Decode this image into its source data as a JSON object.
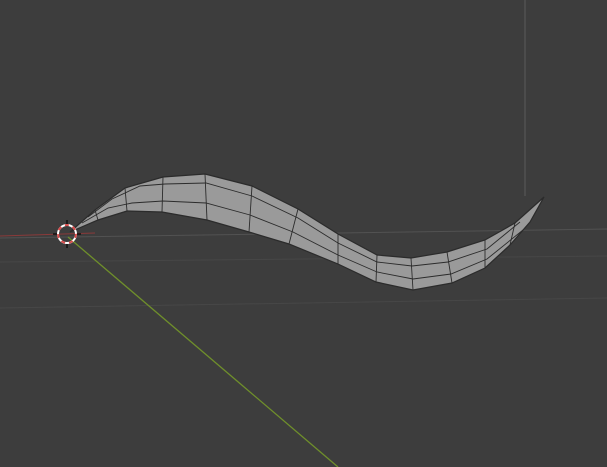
{
  "app": {
    "name": "",
    "mode": "3d-viewport"
  },
  "viewport": {
    "background_color": "#3d3d3d",
    "grid": {
      "visible": true,
      "line_color": "#474747",
      "horizon_color": "#525252"
    },
    "axes": {
      "x_axis_color": "#8a3a3a",
      "y_axis_color": "#6f8f2b",
      "z_axis_color": "#5a5a5a"
    },
    "mesh_object": {
      "name": "",
      "type": "curved-horn-mesh",
      "fill_color": "#9a9a9a",
      "edge_color": "#2b2b2b",
      "shading": "solid"
    },
    "cursor_3d": {
      "icon": "crosshair-3d-cursor-icon",
      "primary_color": "#d84a4a",
      "secondary_color": "#ffffff"
    }
  }
}
